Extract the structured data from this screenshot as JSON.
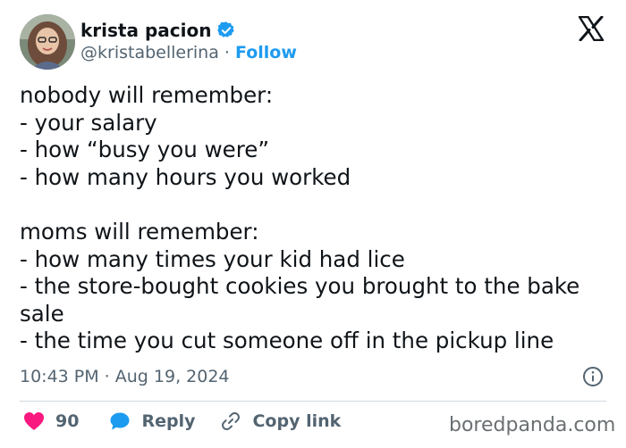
{
  "author": {
    "display_name": "krista pacion",
    "handle": "@kristabellerina",
    "separator": "·",
    "follow_label": "Follow",
    "verified_color": "#1d9bf0"
  },
  "icons": {
    "platform": "x-logo-icon",
    "verified": "verified-badge-icon",
    "info": "info-icon",
    "like": "heart-icon",
    "reply": "speech-bubble-icon",
    "copy": "link-icon"
  },
  "tweet": {
    "lines": [
      "nobody will remember:",
      "- your salary",
      "- how “busy you were”",
      "- how many hours you worked",
      "",
      "moms will remember:",
      "- how many times your kid had lice",
      "- the store-bought cookies you brought to the bake sale",
      "- the time you cut someone off in the pickup line"
    ]
  },
  "timestamp": "10:43 PM · Aug 19, 2024",
  "actions": {
    "like_count": "90",
    "reply_label": "Reply",
    "copy_label": "Copy link"
  },
  "colors": {
    "accent": "#1d9bf0",
    "like": "#f91880",
    "muted": "#536471"
  },
  "watermark": "boredpanda.com"
}
